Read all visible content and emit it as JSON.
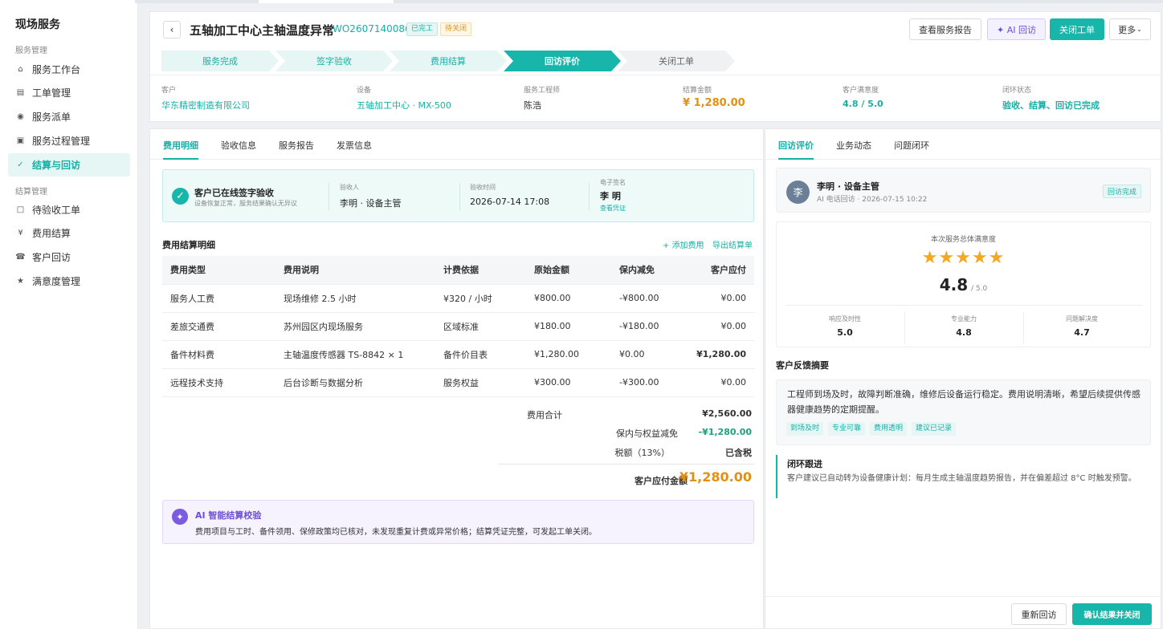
{
  "sidebar": {
    "title": "现场服务",
    "group1": "服务管理",
    "items1": [
      {
        "icon": "⌂",
        "label": "服务工作台"
      },
      {
        "icon": "▤",
        "label": "工单管理"
      },
      {
        "icon": "◉",
        "label": "服务派单"
      },
      {
        "icon": "▣",
        "label": "服务过程管理"
      },
      {
        "icon": "✓",
        "label": "结算与回访"
      }
    ],
    "group2": "结算管理",
    "items2": [
      {
        "icon": "□",
        "label": "待验收工单"
      },
      {
        "icon": "¥",
        "label": "费用结算"
      },
      {
        "icon": "☎",
        "label": "客户回访"
      },
      {
        "icon": "★",
        "label": "满意度管理"
      }
    ]
  },
  "header": {
    "back": "‹",
    "title": "五轴加工中心主轴温度异常",
    "order_id": "WO2607140086",
    "badge_done": "已完工",
    "badge_wait": "待关闭",
    "btn_report": "查看服务报告",
    "btn_ai": "✦ AI 回访",
    "btn_close": "关闭工单",
    "btn_more": "更多",
    "btn_more_caret": "⌄",
    "steps": [
      "服务完成",
      "签字验收",
      "费用结算",
      "回访评价",
      "关闭工单"
    ],
    "info": [
      {
        "label": "客户",
        "value": "华东精密制造有限公司"
      },
      {
        "label": "设备",
        "value": "五轴加工中心 · MX-500"
      },
      {
        "label": "服务工程师",
        "value": "陈浩"
      },
      {
        "label": "结算金额",
        "value": "¥ 1,280.00"
      },
      {
        "label": "客户满意度",
        "value": "4.8 / 5.0"
      },
      {
        "label": "闭环状态",
        "value": "验收、结算、回访已完成"
      }
    ]
  },
  "left": {
    "tabs": [
      "费用明细",
      "验收信息",
      "服务报告",
      "发票信息"
    ],
    "accept": {
      "check": "✓",
      "title": "客户已在线签字验收",
      "sub": "设备恢复正常，服务结果确认无异议",
      "acceptor_label": "验收人",
      "acceptor": "李明 · 设备主管",
      "time_label": "验收时间",
      "time": "2026-07-14 17:08",
      "sign_label": "电子签名",
      "sign": "李 明",
      "sign_link": "查看凭证"
    },
    "section_title": "费用结算明细",
    "add_fee": "+ 添加费用",
    "export": "导出结算单",
    "columns": [
      "费用类型",
      "费用说明",
      "计费依据",
      "原始金额",
      "保内减免",
      "客户应付"
    ],
    "rows": [
      [
        "服务人工费",
        "现场维修 2.5 小时",
        "¥320 / 小时",
        "¥800.00",
        "-¥800.00",
        "¥0.00"
      ],
      [
        "差旅交通费",
        "苏州园区内现场服务",
        "区域标准",
        "¥180.00",
        "-¥180.00",
        "¥0.00"
      ],
      [
        "备件材料费",
        "主轴温度传感器 TS-8842 × 1",
        "备件价目表",
        "¥1,280.00",
        "¥0.00",
        "¥1,280.00"
      ],
      [
        "远程技术支持",
        "后台诊断与数据分析",
        "服务权益",
        "¥300.00",
        "-¥300.00",
        "¥0.00"
      ]
    ],
    "summary": {
      "total_label": "费用合计",
      "total": "¥2,560.00",
      "discount_label": "保内与权益减免",
      "discount": "-¥1,280.00",
      "tax_label": "税额（13%）",
      "tax": "已含税",
      "payable_label": "客户应付金额",
      "payable": "¥1,280.00"
    },
    "ai": {
      "icon": "✦",
      "title": "AI 智能结算校验",
      "text": "费用项目与工时、备件领用、保修政策均已核对，未发现重复计费或异常价格；结算凭证完整，可发起工单关闭。"
    }
  },
  "right": {
    "tabs": [
      "回访评价",
      "业务动态",
      "问题闭环"
    ],
    "visit": {
      "avatar": "李",
      "name": "李明 · 设备主管",
      "sub": "AI 电话回访 · 2026-07-15 10:22",
      "badge": "回访完成"
    },
    "rating": {
      "caption": "本次服务总体满意度",
      "stars": "★★★★★",
      "score": "4.8",
      "max": "/ 5.0",
      "subs": [
        {
          "label": "响应及时性",
          "value": "5.0"
        },
        {
          "label": "专业能力",
          "value": "4.8"
        },
        {
          "label": "问题解决度",
          "value": "4.7"
        }
      ]
    },
    "feedback_title": "客户反馈摘要",
    "feedback": "工程师到场及时，故障判断准确，维修后设备运行稳定。费用说明清晰，希望后续提供传感器健康趋势的定期提醒。",
    "tags": [
      "到场及时",
      "专业可靠",
      "费用透明",
      "建议已记录"
    ],
    "loop_title": "闭环跟进",
    "loop_text": "客户建议已自动转为设备健康计划：每月生成主轴温度趋势报告，并在偏差超过 8°C 时触发预警。",
    "btn_revisit": "重新回访",
    "btn_confirm": "确认结果并关闭"
  }
}
